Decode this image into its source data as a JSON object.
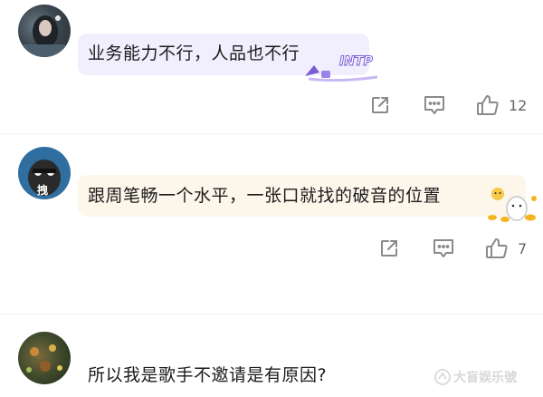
{
  "comments": [
    {
      "text": "业务能力不行，人品也不行",
      "sticker_text": "INTP",
      "like_count": "12"
    },
    {
      "avatar_label": "拽",
      "text": "跟周笔畅一个水平，一张口就找的破音的位置",
      "like_count": "7"
    },
    {
      "text": "所以我是歌手不邀请是有原因?"
    }
  ],
  "watermark": "大盲娱乐號",
  "colors": {
    "bubble1": "#f1eefe",
    "bubble2": "#fdf6ea",
    "icon": "#8a8a8a",
    "count": "#666666"
  }
}
